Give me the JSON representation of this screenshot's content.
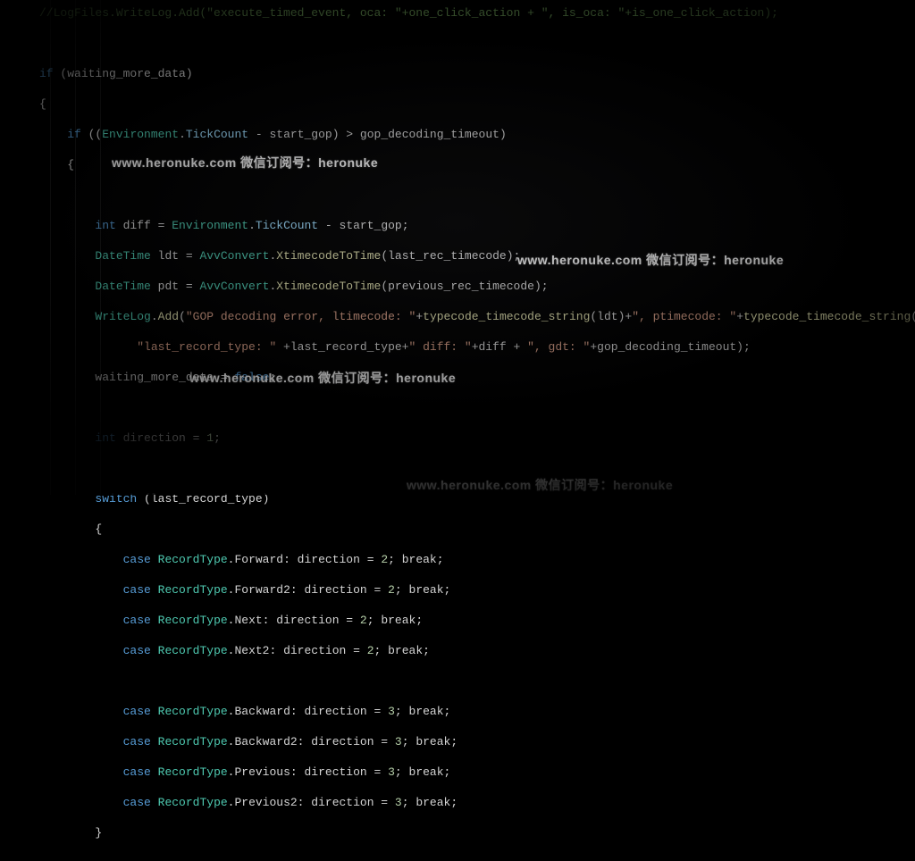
{
  "code": {
    "line1": "//LogFiles.WriteLog.Add(\"execute_timed_event, oca: \"+one_click_action + \", is_oca: \"+is_one_click_action);",
    "line2": "",
    "line3_kw_if": "if",
    "line3_cond": " (waiting_more_data)",
    "line4": "{",
    "line5_indent": "    ",
    "line5_kw_if": "if",
    "line5_rest": " ((",
    "line5_type": "Environment",
    "line5_dot": ".",
    "line5_prop": "TickCount",
    "line5_rest2": " - start_gop) > gop_decoding_timeout)",
    "line6": "    {",
    "line7": "",
    "line8_indent": "        ",
    "line8_type": "int",
    "line8_mid": " diff = ",
    "line8_env": "Environment",
    "line8_dot": ".",
    "line8_prop": "TickCount",
    "line8_end": " - start_gop;",
    "line9_indent": "        ",
    "line9_type": "DateTime",
    "line9_mid": " ldt = ",
    "line9_cls": "AvvConvert",
    "line9_dot": ".",
    "line9_method": "XtimecodeToTime",
    "line9_end": "(last_rec_timecode);",
    "line10_indent": "        ",
    "line10_type": "DateTime",
    "line10_mid": " pdt = ",
    "line10_cls": "AvvConvert",
    "line10_dot": ".",
    "line10_method": "XtimecodeToTime",
    "line10_end": "(previous_rec_timecode);",
    "line11_indent": "        ",
    "line11_cls": "WriteLog",
    "line11_dot": ".",
    "line11_method": "Add",
    "line11_open": "(",
    "line11_str1": "\"GOP decoding error, ltimecode: \"",
    "line11_mid1": "+",
    "line11_fn1": "typecode_timecode_string",
    "line11_arg1": "(ldt)+",
    "line11_str2": "\", ptimecode: \"",
    "line11_mid2": "+",
    "line11_fn2": "typecode_timecode_string",
    "line11_arg2": "(pdt) +",
    "line12_indent": "              ",
    "line12_str1": "\"last_record_type: \"",
    "line12_mid1": " +last_record_type+",
    "line12_str2": "\" diff: \"",
    "line12_mid2": "+diff + ",
    "line12_str3": "\", gdt: \"",
    "line12_end": "+gop_decoding_timeout);",
    "line13_indent": "        ",
    "line13_rest": "waiting_more_data = ",
    "line13_kw": "false",
    "line13_end": ";",
    "line14": "",
    "line15_indent": "        ",
    "line15_type": "int",
    "line15_rest": " direction = ",
    "line15_num": "1",
    "line15_end": ";",
    "line16": "",
    "line17_indent": "        ",
    "line17_kw": "switch",
    "line17_rest": " (last_record_type)",
    "line18": "        {",
    "case_indent": "            ",
    "case_kw": "case",
    "case_type": "RecordType",
    "c1_mem": ".Forward: direction = ",
    "c1_num": "2",
    "break_part": "; break;",
    "c2_mem": ".Forward2: direction = ",
    "c2_num": "2",
    "c3_mem": ".Next: direction = ",
    "c3_num": "2",
    "c4_mem": ".Next2: direction = ",
    "c4_num": "2",
    "c5_mem": ".Backward: direction = ",
    "c5_num": "3",
    "c6_mem": ".Backward2: direction = ",
    "c6_num": "3",
    "c7_mem": ".Previous: direction = ",
    "c7_num": "3",
    "c8_mem": ".Previous2: direction = ",
    "c8_num": "3",
    "line28": "        }"
  },
  "watermarks": {
    "text": "www.heronuke.com  微信订阅号：heronuke"
  }
}
